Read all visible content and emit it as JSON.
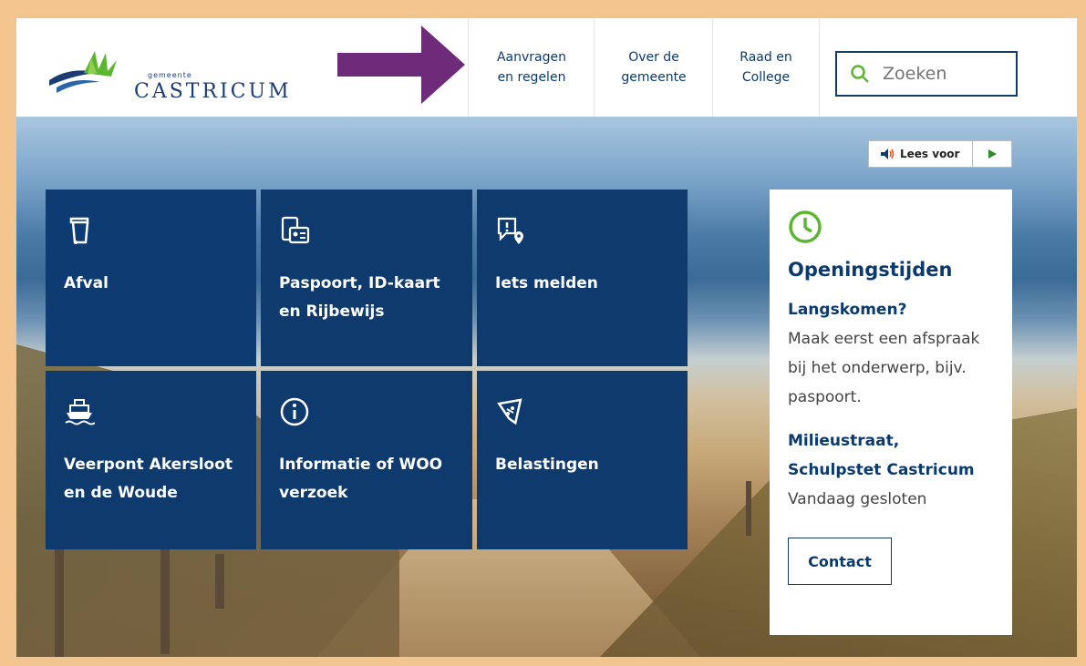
{
  "header": {
    "logo_small": "gemeente",
    "logo_main": "CASTRICUM",
    "nav": [
      {
        "line1": "Aanvragen",
        "line2": "en regelen"
      },
      {
        "line1": "Over de",
        "line2": "gemeente"
      },
      {
        "line1": "Raad en",
        "line2": "College"
      }
    ],
    "search_placeholder": "Zoeken"
  },
  "readspeaker": {
    "label": "Lees voor"
  },
  "tiles": [
    {
      "title": "Afval",
      "icon": "trash-bin-icon"
    },
    {
      "title": "Paspoort, ID-kaart en Rijbewijs",
      "icon": "id-card-icon"
    },
    {
      "title": "Iets melden",
      "icon": "report-location-icon"
    },
    {
      "title": "Veerpont Akersloot en de Woude",
      "icon": "ferry-icon"
    },
    {
      "title": "Informatie of WOO verzoek",
      "icon": "info-icon"
    },
    {
      "title": "Belastingen",
      "icon": "tax-ticket-icon"
    }
  ],
  "openings": {
    "title": "Openingstijden",
    "block1_title": "Langskomen?",
    "block1_text": "Maak eerst een afspraak bij het onderwerp, bijv. paspoort.",
    "block2_title": "Milieustraat, Schulpstet Castricum",
    "block2_text": "Vandaag gesloten",
    "contact_label": "Contact"
  },
  "colors": {
    "primary": "#0f3a6d",
    "accent_green": "#5cb531",
    "arrow": "#6d2b7a",
    "frame": "#f2c48e"
  }
}
